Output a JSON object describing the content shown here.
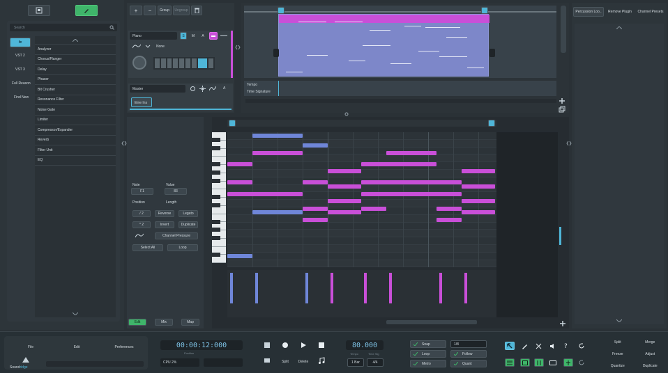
{
  "left": {
    "search_placeholder": "Search",
    "tabs": [
      {
        "label": "fx"
      },
      {
        "label": "VST 2"
      },
      {
        "label": "VST 3"
      },
      {
        "label": "Full Reason"
      },
      {
        "label": "Find New"
      }
    ],
    "effects": [
      "Analyzer",
      "Chorus/Flanger",
      "Delay",
      "Phaser",
      "Bit Crusher",
      "Resonance Filter",
      "Noise Gate",
      "Limiter",
      "Compressor/Expander",
      "Reverb",
      "Filter Unit",
      "EQ"
    ]
  },
  "track_toolbar": {
    "add": "+",
    "remove": "−",
    "group": "Group",
    "ungroup": "Ungroup"
  },
  "track1": {
    "name": "Piano",
    "solo": "S",
    "mute": "M",
    "auto": "A",
    "lane": "None"
  },
  "master": {
    "name": "Master",
    "auto": "A",
    "device": "Eine Ins"
  },
  "arrange": {
    "tempo": "Tempo",
    "time_sig": "Time Signature"
  },
  "editor": {
    "note_label": "Note",
    "note_value": "F1",
    "value_label": "Value",
    "value_value": "83",
    "position": "Position",
    "length": "Length",
    "half": "/ 2",
    "reverse": "Reverse",
    "legato": "Legato",
    "double": "* 2",
    "invert": "Invert",
    "duplicate": "Duplicate",
    "channel_pressure": "Channel Pressure",
    "select_all": "Select All",
    "loop": "Loop"
  },
  "bottom_tabs": {
    "edit": "Edit",
    "mix": "Mix",
    "map": "Map"
  },
  "right_tabs": [
    "Percussion Loo..",
    "Remove Plugin",
    "Channel Presets"
  ],
  "transport": {
    "file": "File",
    "edit": "Edit",
    "preferences": "Preferences",
    "time": "00:00:12:000",
    "time_sub": "Position",
    "cpu": "CPU 2%",
    "bpm": "80.000",
    "tempo_label": "Tempo",
    "timesig_label": "Time Sig",
    "bars": "1 Bar",
    "sig": "4/4",
    "split": "Split",
    "delete": "Delete",
    "snap": "Snap",
    "snap_value": "1/8",
    "loop": "Loop",
    "follow": "Follow",
    "metro": "Metro",
    "quant": "Quant",
    "right_actions": [
      "Split",
      "Merge",
      "Freeze",
      "Adjust",
      "Quantize",
      "Duplicate"
    ],
    "logo_a": "Sound",
    "logo_b": "ridge"
  },
  "colors": {
    "accent": "#4fb6d8",
    "note_pink": "#c94fd8",
    "note_blue": "#6f86d8",
    "green": "#3fb56a"
  }
}
